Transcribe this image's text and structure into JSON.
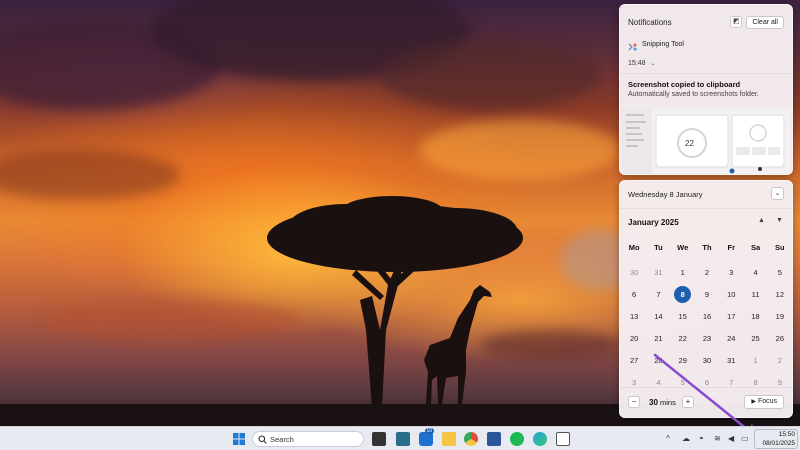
{
  "notifications": {
    "title": "Notifications",
    "clear_all_label": "Clear all",
    "app_name": "Snipping Tool",
    "time": "15:48",
    "heading": "Screenshot copied to clipboard",
    "subtext": "Automatically saved to screenshots folder.",
    "thumbnail_focus_label": "22"
  },
  "calendar": {
    "date_header": "Wednesday 8 January",
    "month_label": "January 2025",
    "weekdays": [
      "Mo",
      "Tu",
      "We",
      "Th",
      "Fr",
      "Sa",
      "Su"
    ],
    "weeks": [
      [
        "30",
        "31",
        "1",
        "2",
        "3",
        "4",
        "5"
      ],
      [
        "6",
        "7",
        "8",
        "9",
        "10",
        "11",
        "12"
      ],
      [
        "13",
        "14",
        "15",
        "16",
        "17",
        "18",
        "19"
      ],
      [
        "20",
        "21",
        "22",
        "23",
        "24",
        "25",
        "26"
      ],
      [
        "27",
        "28",
        "29",
        "30",
        "31",
        "1",
        "2"
      ],
      [
        "3",
        "4",
        "5",
        "6",
        "7",
        "8",
        "9"
      ]
    ],
    "today": "8",
    "focus_minutes": "30",
    "focus_unit": "mins",
    "focus_label": "Focus"
  },
  "taskbar": {
    "search_placeholder": "Search",
    "badge_count": "10",
    "clock_time": "15:50",
    "clock_date": "08/01/2025"
  },
  "colors": {
    "accent": "#1f5fb0",
    "arrow": "#8a4ad0"
  },
  "icons": {
    "start": "windows-logo-icon",
    "search": "search-icon",
    "focus": "play-icon",
    "clear": "clear-notifications-icon"
  }
}
